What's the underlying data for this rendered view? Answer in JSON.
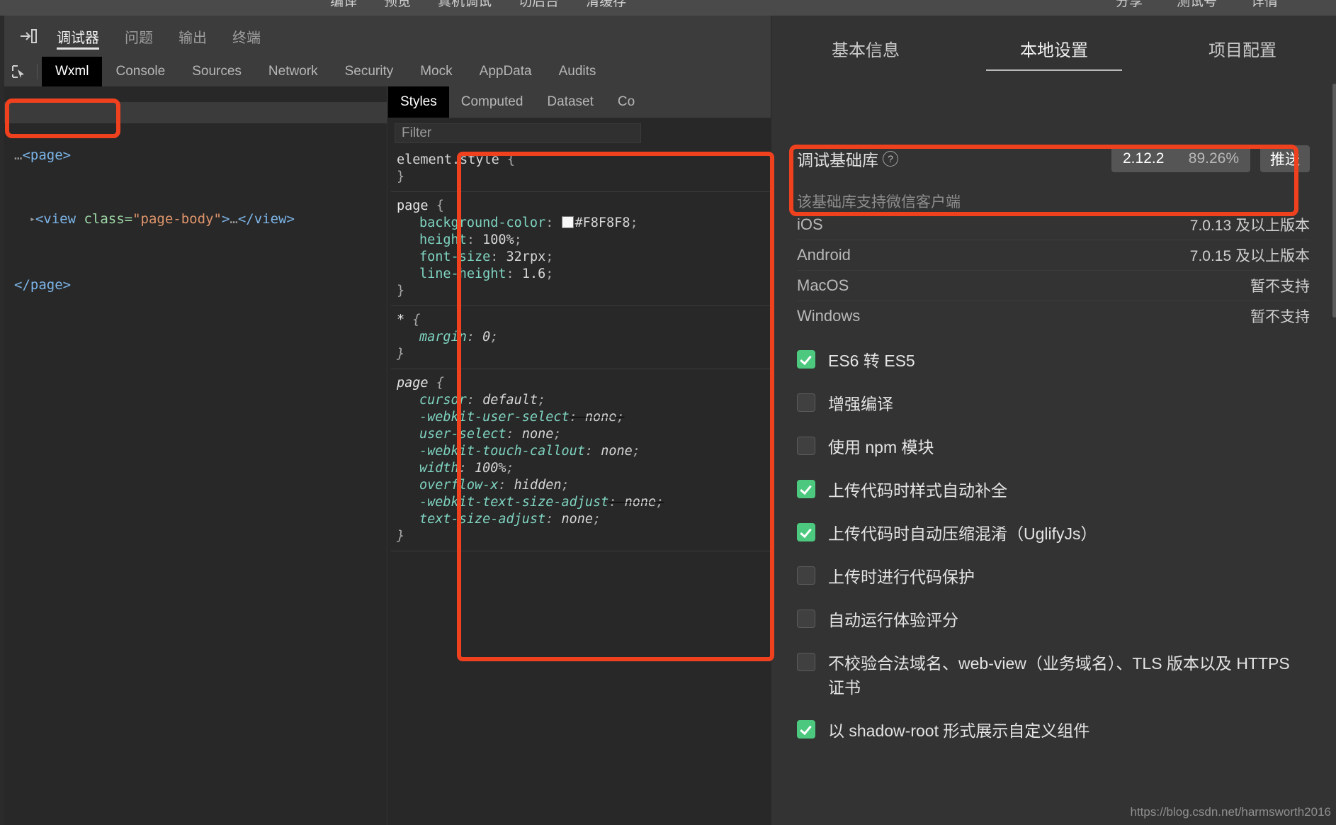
{
  "window_toolbar": {
    "left_items": [
      "编译",
      "预览",
      "真机调试",
      "切后台",
      "清缓存"
    ],
    "right_items": [
      "分享",
      "测试号",
      "详情"
    ]
  },
  "devtools": {
    "dock_icon": "dock-to-right-icon",
    "panel_tabs": [
      {
        "label": "调试器",
        "active": true
      },
      {
        "label": "问题",
        "active": false
      },
      {
        "label": "输出",
        "active": false
      },
      {
        "label": "终端",
        "active": false
      }
    ],
    "picker_icon": "element-picker-icon",
    "tool_tabs": [
      {
        "label": "Wxml",
        "active": true
      },
      {
        "label": "Console",
        "active": false
      },
      {
        "label": "Sources",
        "active": false
      },
      {
        "label": "Network",
        "active": false
      },
      {
        "label": "Security",
        "active": false
      },
      {
        "label": "Mock",
        "active": false
      },
      {
        "label": "AppData",
        "active": false
      },
      {
        "label": "Audits",
        "active": false
      }
    ],
    "dom_tree": {
      "selected_line": {
        "dots": "…",
        "tag": "<page>"
      },
      "child_line": {
        "triangle": "▸",
        "open_tag": "<view ",
        "attr_name": "class=",
        "attr_value": "\"page-body\"",
        "close_bracket": ">",
        "ellipsis": "…",
        "close_tag": "</view>"
      },
      "closing_line": "</page>"
    },
    "styles": {
      "tabs": [
        {
          "label": "Styles",
          "active": true
        },
        {
          "label": "Computed",
          "active": false
        },
        {
          "label": "Dataset",
          "active": false
        },
        {
          "label": "Co",
          "active": false
        }
      ],
      "filter_placeholder": "Filter",
      "rules": [
        {
          "selector": "element.style",
          "style": "dim",
          "declarations": []
        },
        {
          "selector": "page",
          "style": "normal",
          "declarations": [
            {
              "prop": "background-color",
              "value": "#F8F8F8",
              "swatch": "#F8F8F8",
              "struck": false
            },
            {
              "prop": "height",
              "value": "100%",
              "struck": false
            },
            {
              "prop": "font-size",
              "value": "32rpx",
              "struck": false
            },
            {
              "prop": "line-height",
              "value": "1.6",
              "struck": false
            }
          ]
        },
        {
          "selector": "*",
          "style": "ua",
          "declarations": [
            {
              "prop": "margin",
              "value": "0",
              "struck": false
            }
          ]
        },
        {
          "selector": "page",
          "style": "ua",
          "declarations": [
            {
              "prop": "cursor",
              "value": "default",
              "struck": false
            },
            {
              "prop": "-webkit-user-select",
              "value": "none",
              "struck": true
            },
            {
              "prop": "user-select",
              "value": "none",
              "struck": false
            },
            {
              "prop": "-webkit-touch-callout",
              "value": "none",
              "struck": false
            },
            {
              "prop": "width",
              "value": "100%",
              "struck": false
            },
            {
              "prop": "overflow-x",
              "value": "hidden",
              "struck": false
            },
            {
              "prop": "-webkit-text-size-adjust",
              "value": "none",
              "struck": true
            },
            {
              "prop": "text-size-adjust",
              "value": "none",
              "struck": false
            }
          ]
        }
      ]
    }
  },
  "detail_panel": {
    "tabs": [
      {
        "label": "基本信息",
        "active": false
      },
      {
        "label": "本地设置",
        "active": true
      },
      {
        "label": "项目配置",
        "active": false
      }
    ],
    "base_library": {
      "label": "调试基础库",
      "help_icon": "question-mark-icon",
      "version": "2.12.2",
      "coverage": "89.26%",
      "push_button": "推送"
    },
    "support_note": "该基础库支持微信客户端",
    "support_rows": [
      {
        "platform": "iOS",
        "version": "7.0.13 及以上版本"
      },
      {
        "platform": "Android",
        "version": "7.0.15 及以上版本"
      },
      {
        "platform": "MacOS",
        "version": "暂不支持"
      },
      {
        "platform": "Windows",
        "version": "暂不支持"
      }
    ],
    "options": [
      {
        "label": "ES6 转 ES5",
        "checked": true
      },
      {
        "label": "增强编译",
        "checked": false
      },
      {
        "label": "使用 npm 模块",
        "checked": false
      },
      {
        "label": "上传代码时样式自动补全",
        "checked": true
      },
      {
        "label": "上传代码时自动压缩混淆（UglifyJs）",
        "checked": true
      },
      {
        "label": "上传时进行代码保护",
        "checked": false
      },
      {
        "label": "自动运行体验评分",
        "checked": false
      },
      {
        "label": "不校验合法域名、web-view（业务域名）、TLS 版本以及 HTTPS 证书",
        "checked": false
      },
      {
        "label": "以 shadow-root 形式展示自定义组件",
        "checked": true
      }
    ]
  },
  "watermark": "https://blog.csdn.net/harmsworth2016",
  "annotations": {
    "color": "#f0411f",
    "boxes": [
      {
        "name": "dom-selected-node-highlight"
      },
      {
        "name": "styles-panel-highlight"
      },
      {
        "name": "base-library-highlight"
      }
    ]
  }
}
